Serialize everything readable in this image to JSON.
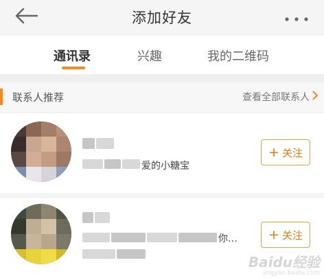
{
  "header": {
    "title": "添加好友"
  },
  "tabs": [
    {
      "label": "通讯录",
      "active": true
    },
    {
      "label": "兴趣",
      "active": false
    },
    {
      "label": "我的二维码",
      "active": false
    }
  ],
  "section": {
    "title": "联系人推荐",
    "view_all": "查看全部联系人"
  },
  "contacts": [
    {
      "desc_tail": "爱的小糖宝",
      "follow_label": "关注"
    },
    {
      "desc_tail": "你…",
      "follow_label": "关注"
    }
  ],
  "watermark": {
    "logo": "Baidu经验",
    "sub": "jingyan.baidu.com"
  },
  "colors": {
    "accent": "#f7891f",
    "follow_border": "#f0a040",
    "follow_text": "#e07d10"
  }
}
